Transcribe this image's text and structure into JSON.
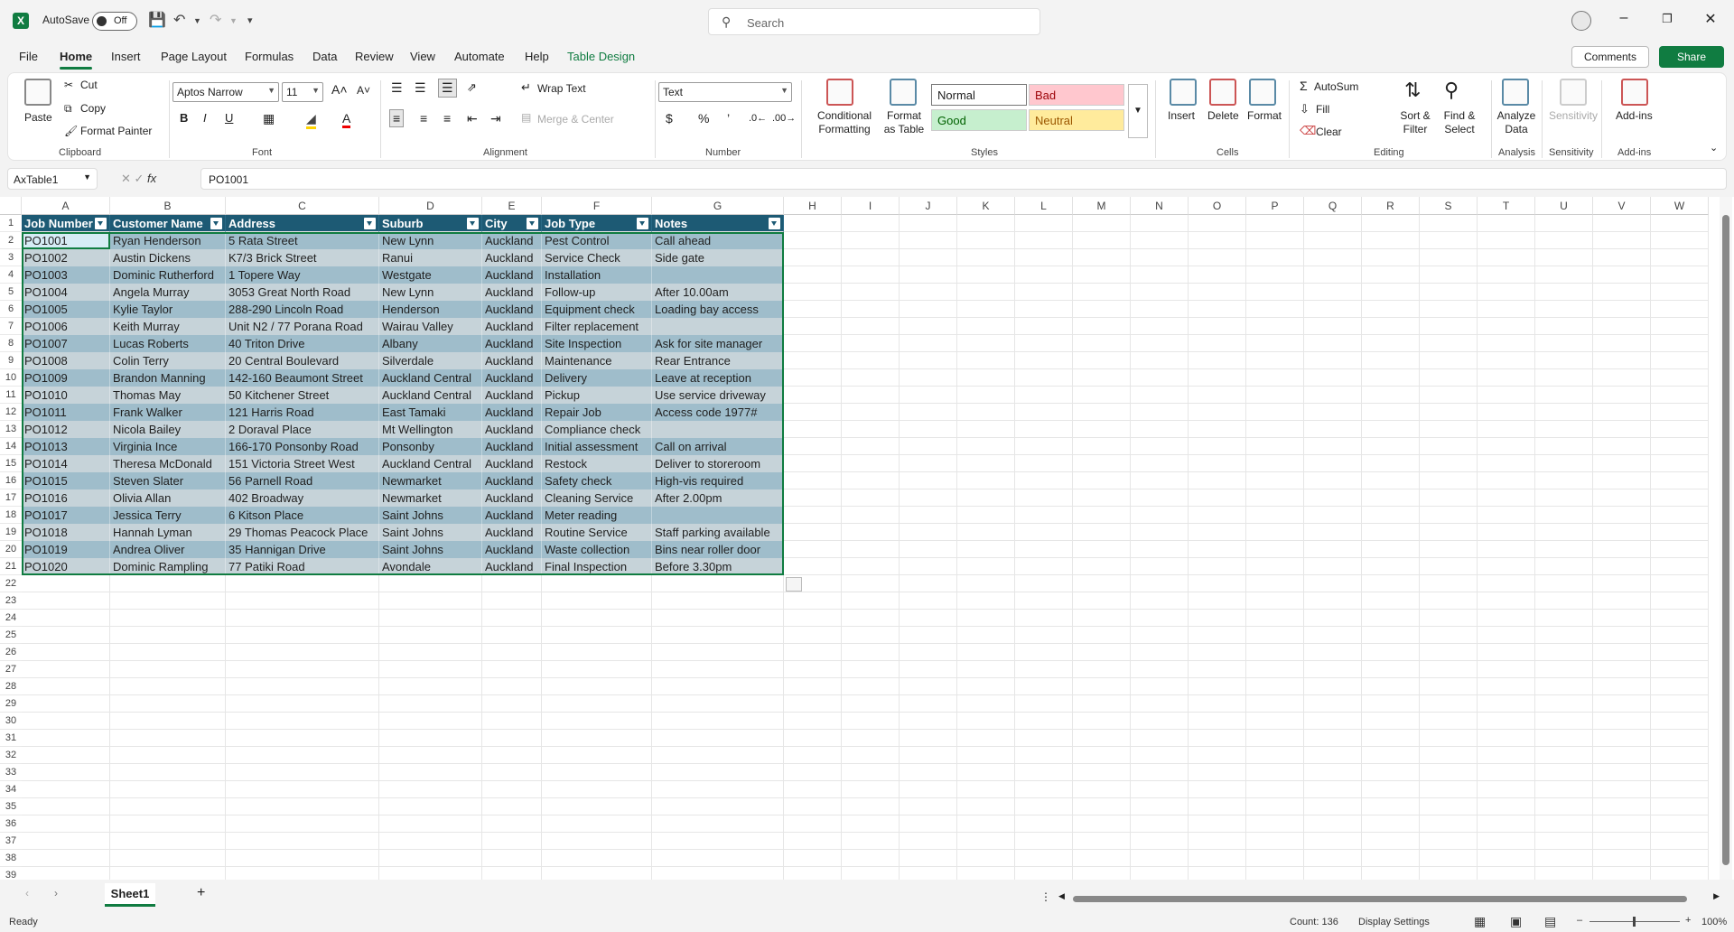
{
  "window": {
    "autosave_label": "AutoSave",
    "autosave_state": "Off",
    "search_placeholder": "Search"
  },
  "menu": [
    "File",
    "Home",
    "Insert",
    "Page Layout",
    "Formulas",
    "Data",
    "Review",
    "View",
    "Automate",
    "Help",
    "Table Design"
  ],
  "menu_active": "Home",
  "actions": {
    "comments": "Comments",
    "share": "Share"
  },
  "ribbon": {
    "clipboard": {
      "paste": "Paste",
      "cut": "Cut",
      "copy": "Copy",
      "format_painter": "Format Painter",
      "group": "Clipboard"
    },
    "font": {
      "name": "Aptos Narrow",
      "size": "11",
      "group": "Font"
    },
    "alignment": {
      "wrap": "Wrap Text",
      "merge": "Merge & Center",
      "group": "Alignment"
    },
    "number": {
      "format": "Text",
      "group": "Number"
    },
    "styles": {
      "conditional": "Conditional Formatting",
      "format_table": "Format as Table",
      "normal": "Normal",
      "bad": "Bad",
      "good": "Good",
      "neutral": "Neutral",
      "group": "Styles"
    },
    "cells": {
      "insert": "Insert",
      "delete": "Delete",
      "format": "Format",
      "group": "Cells"
    },
    "editing": {
      "autosum": "AutoSum",
      "fill": "Fill",
      "clear": "Clear",
      "sort": "Sort & Filter",
      "find": "Find & Select",
      "group": "Editing"
    },
    "analysis": {
      "analyze": "Analyze Data",
      "group": "Analysis"
    },
    "sensitivity": {
      "label": "Sensitivity",
      "group": "Sensitivity"
    },
    "addins": {
      "label": "Add-ins",
      "group": "Add-ins"
    }
  },
  "formula_bar": {
    "name_box": "AxTable1",
    "fx": "fx",
    "value": "PO1001"
  },
  "columns": [
    "A",
    "B",
    "C",
    "D",
    "E",
    "F",
    "G",
    "H",
    "I",
    "J",
    "K",
    "L",
    "M",
    "N",
    "O",
    "P",
    "Q",
    "R",
    "S",
    "T",
    "U",
    "V",
    "W"
  ],
  "table": {
    "headers": [
      "Job Number",
      "Customer Name",
      "Address",
      "Suburb",
      "City",
      "Job Type",
      "Notes"
    ],
    "rows": [
      [
        "PO1001",
        "Ryan Henderson",
        "5 Rata Street",
        "New Lynn",
        "Auckland",
        "Pest Control",
        "Call ahead"
      ],
      [
        "PO1002",
        "Austin Dickens",
        "K7/3 Brick Street",
        "Ranui",
        "Auckland",
        "Service Check",
        "Side gate"
      ],
      [
        "PO1003",
        "Dominic Rutherford",
        "1 Topere Way",
        "Westgate",
        "Auckland",
        "Installation",
        ""
      ],
      [
        "PO1004",
        "Angela Murray",
        "3053 Great North Road",
        "New Lynn",
        "Auckland",
        "Follow-up",
        "After 10.00am"
      ],
      [
        "PO1005",
        "Kylie Taylor",
        "288-290 Lincoln Road",
        "Henderson",
        "Auckland",
        "Equipment check",
        "Loading bay access"
      ],
      [
        "PO1006",
        "Keith Murray",
        "Unit N2 / 77 Porana Road",
        "Wairau Valley",
        "Auckland",
        "Filter replacement",
        ""
      ],
      [
        "PO1007",
        "Lucas Roberts",
        "40 Triton Drive",
        "Albany",
        "Auckland",
        "Site Inspection",
        "Ask for site manager"
      ],
      [
        "PO1008",
        "Colin Terry",
        "20 Central Boulevard",
        "Silverdale",
        "Auckland",
        "Maintenance",
        "Rear Entrance"
      ],
      [
        "PO1009",
        "Brandon Manning",
        "142-160 Beaumont Street",
        "Auckland Central",
        "Auckland",
        "Delivery",
        "Leave at reception"
      ],
      [
        "PO1010",
        "Thomas May",
        "50 Kitchener Street",
        "Auckland Central",
        "Auckland",
        "Pickup",
        "Use service driveway"
      ],
      [
        "PO1011",
        "Frank Walker",
        "121 Harris Road",
        "East Tamaki",
        "Auckland",
        "Repair Job",
        "Access code 1977#"
      ],
      [
        "PO1012",
        "Nicola Bailey",
        "2 Doraval Place",
        "Mt Wellington",
        "Auckland",
        "Compliance check",
        ""
      ],
      [
        "PO1013",
        "Virginia Ince",
        "166-170 Ponsonby Road",
        "Ponsonby",
        "Auckland",
        "Initial assessment",
        "Call on arrival"
      ],
      [
        "PO1014",
        "Theresa McDonald",
        "151 Victoria Street West",
        "Auckland Central",
        "Auckland",
        "Restock",
        "Deliver to storeroom"
      ],
      [
        "PO1015",
        "Steven Slater",
        "56 Parnell Road",
        "Newmarket",
        "Auckland",
        "Safety check",
        "High-vis required"
      ],
      [
        "PO1016",
        "Olivia Allan",
        "402 Broadway",
        "Newmarket",
        "Auckland",
        "Cleaning Service",
        "After 2.00pm"
      ],
      [
        "PO1017",
        "Jessica Terry",
        "6 Kitson Place",
        "Saint Johns",
        "Auckland",
        "Meter reading",
        ""
      ],
      [
        "PO1018",
        "Hannah Lyman",
        "29 Thomas Peacock Place",
        "Saint Johns",
        "Auckland",
        "Routine Service",
        "Staff parking available"
      ],
      [
        "PO1019",
        "Andrea Oliver",
        "35 Hannigan Drive",
        "Saint Johns",
        "Auckland",
        "Waste collection",
        "Bins near roller door"
      ],
      [
        "PO1020",
        "Dominic Rampling",
        "77 Patiki Road",
        "Avondale",
        "Auckland",
        "Final Inspection",
        "Before 3.30pm"
      ]
    ]
  },
  "sheet": {
    "tab": "Sheet1",
    "add": "+"
  },
  "status": {
    "ready": "Ready",
    "count": "Count: 136",
    "display_settings": "Display Settings",
    "zoom": "100%"
  },
  "colors": {
    "accent": "#107c41",
    "table_header": "#1d5a74",
    "row_band_1": "#9fbdcb",
    "row_band_2": "#c6d3d9"
  }
}
